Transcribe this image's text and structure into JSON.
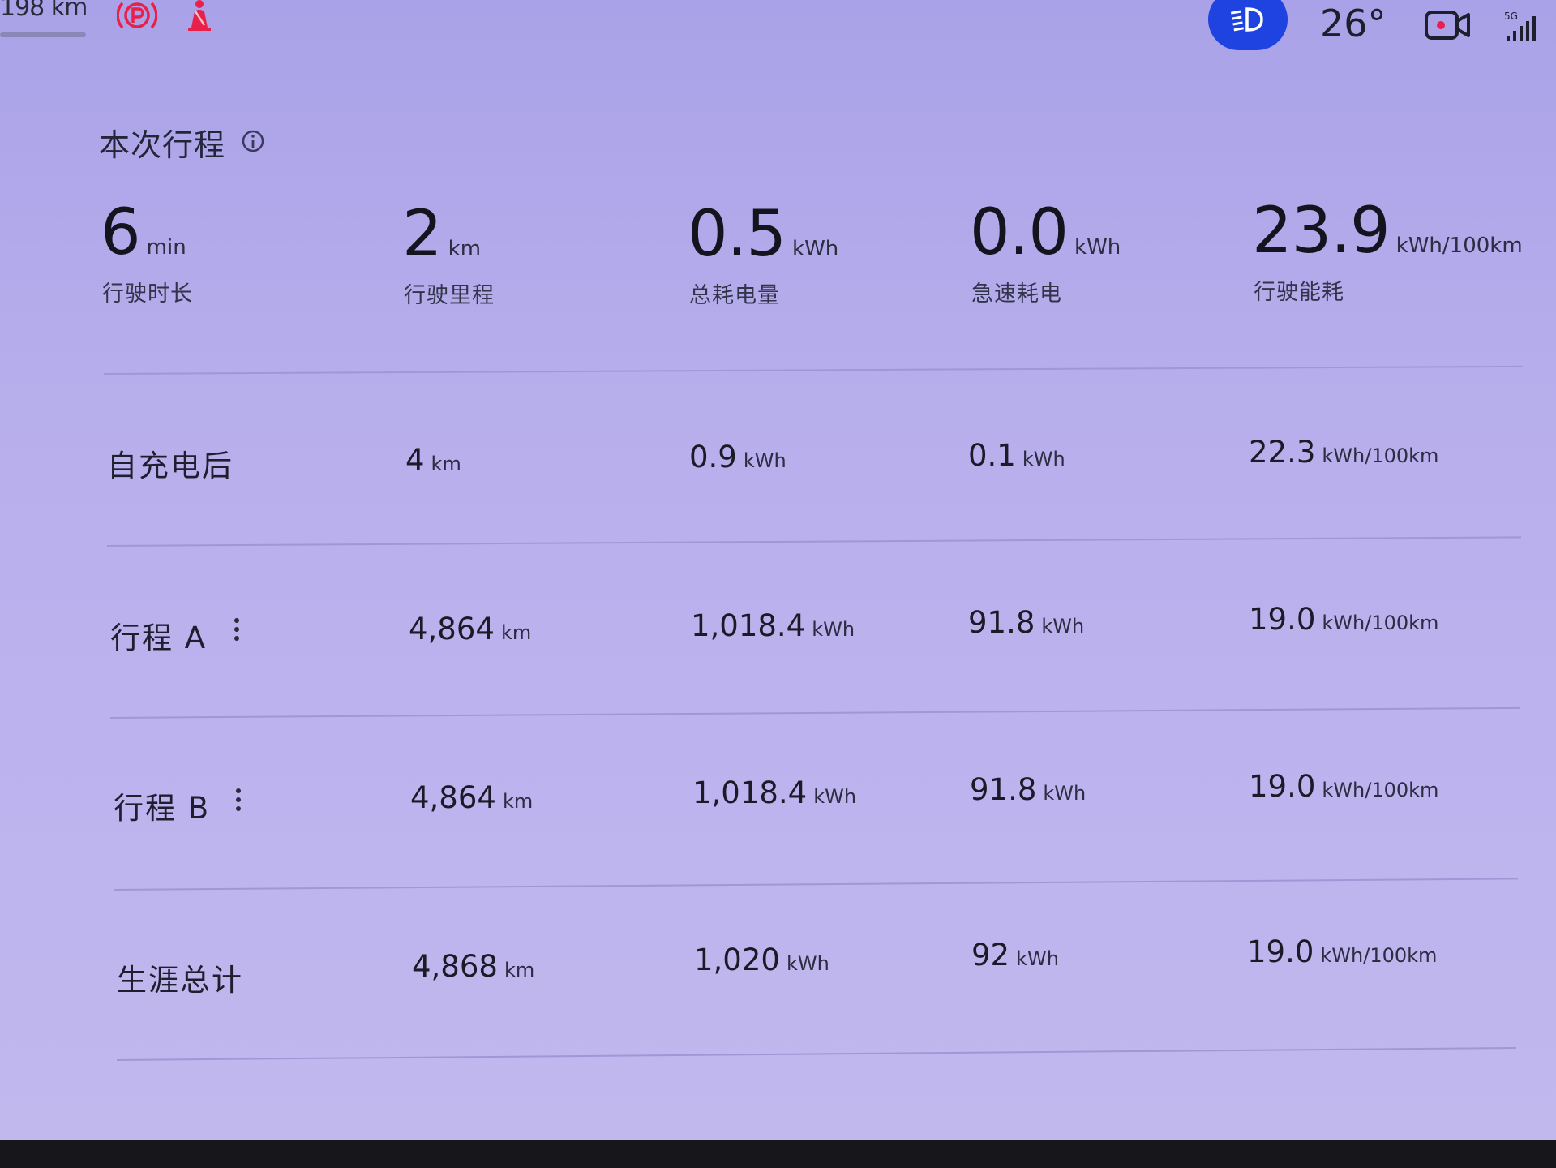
{
  "status_bar": {
    "range": "198 km",
    "temperature": "26°",
    "icons": [
      "parking-brake-icon",
      "seatbelt-warning-icon",
      "headlight-icon",
      "camera-icon",
      "signal-5g-icon"
    ],
    "network": "5G"
  },
  "colors": {
    "background": "#b7aeec",
    "accent_blue": "#1f43e0",
    "warning_red": "#e8204a"
  },
  "current_trip": {
    "title": "本次行程",
    "metrics": [
      {
        "value": "6",
        "unit": "min",
        "label": "行驶时长"
      },
      {
        "value": "2",
        "unit": "km",
        "label": "行驶里程"
      },
      {
        "value": "0.5",
        "unit": "kWh",
        "label": "总耗电量"
      },
      {
        "value": "0.0",
        "unit": "kWh",
        "label": "急速耗电"
      },
      {
        "value": "23.9",
        "unit": "kWh/100km",
        "label": "行驶能耗"
      }
    ]
  },
  "rows": [
    {
      "label": "自充电后",
      "has_menu": false,
      "distance": {
        "value": "4",
        "unit": "km"
      },
      "energy": {
        "value": "0.9",
        "unit": "kWh"
      },
      "idle": {
        "value": "0.1",
        "unit": "kWh"
      },
      "efficiency": {
        "value": "22.3",
        "unit": "kWh/100km"
      }
    },
    {
      "label": "行程 A",
      "has_menu": true,
      "distance": {
        "value": "4,864",
        "unit": "km"
      },
      "energy": {
        "value": "1,018.4",
        "unit": "kWh"
      },
      "idle": {
        "value": "91.8",
        "unit": "kWh"
      },
      "efficiency": {
        "value": "19.0",
        "unit": "kWh/100km"
      }
    },
    {
      "label": "行程 B",
      "has_menu": true,
      "distance": {
        "value": "4,864",
        "unit": "km"
      },
      "energy": {
        "value": "1,018.4",
        "unit": "kWh"
      },
      "idle": {
        "value": "91.8",
        "unit": "kWh"
      },
      "efficiency": {
        "value": "19.0",
        "unit": "kWh/100km"
      }
    },
    {
      "label": "生涯总计",
      "has_menu": false,
      "distance": {
        "value": "4,868",
        "unit": "km"
      },
      "energy": {
        "value": "1,020",
        "unit": "kWh"
      },
      "idle": {
        "value": "92",
        "unit": "kWh"
      },
      "efficiency": {
        "value": "19.0",
        "unit": "kWh/100km"
      }
    }
  ]
}
